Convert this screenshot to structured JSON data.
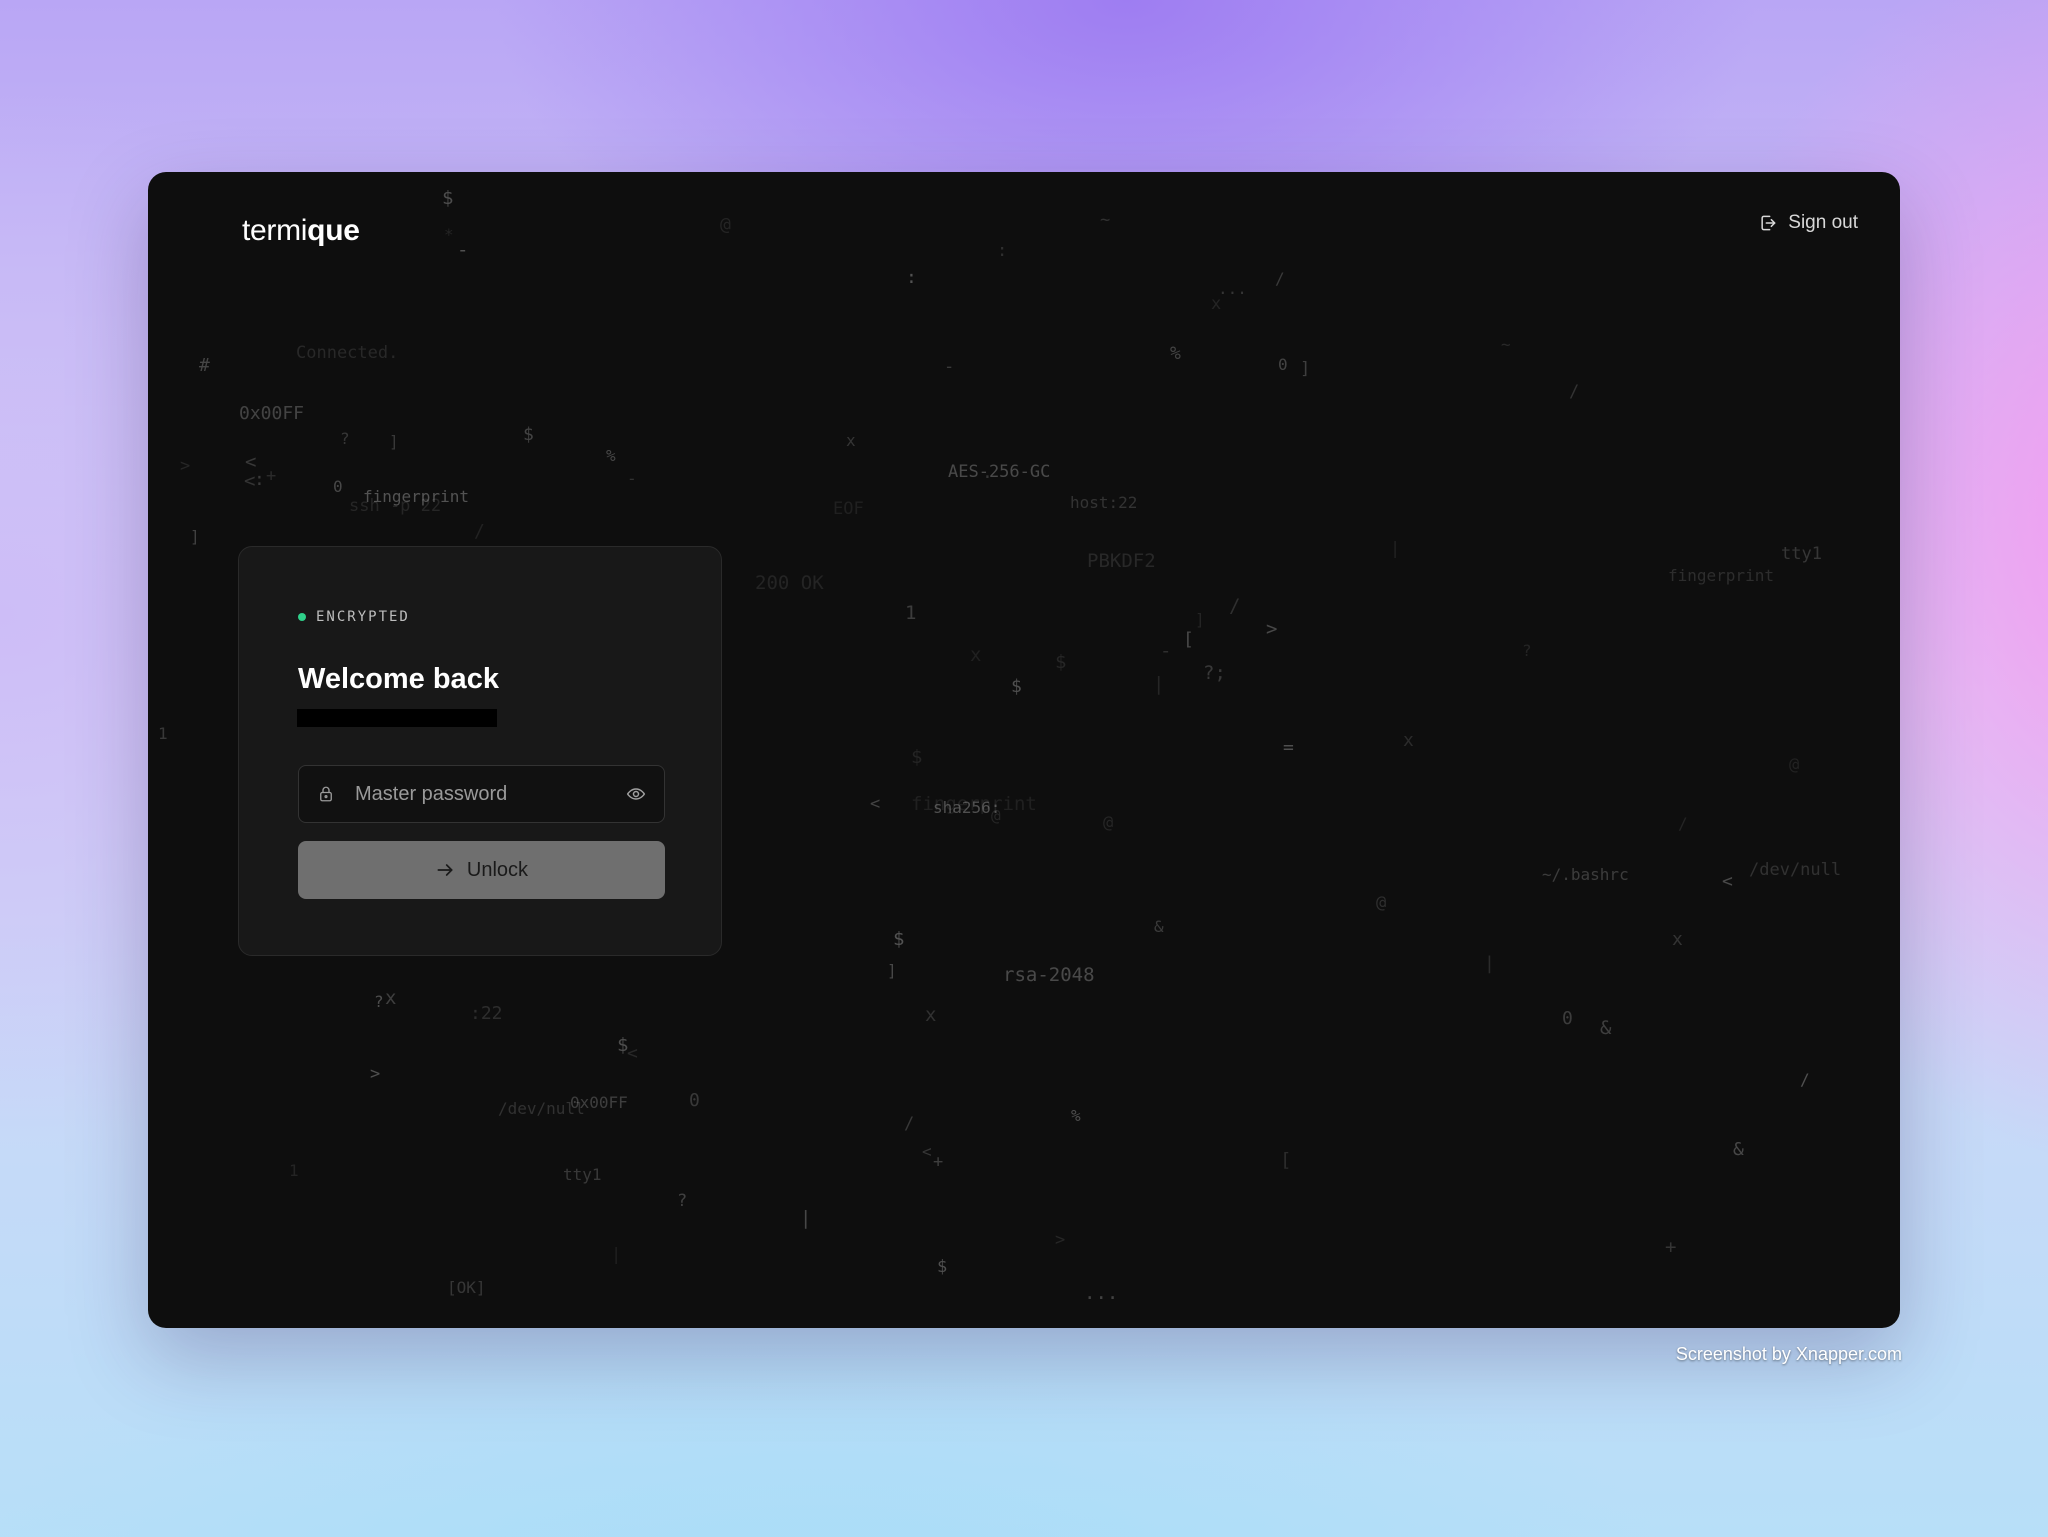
{
  "app": {
    "logo_light": "termi",
    "logo_bold": "que"
  },
  "header": {
    "signout_label": "Sign out",
    "signout_icon": "sign-out-icon"
  },
  "card": {
    "badge": "ENCRYPTED",
    "badge_color": "#2fd08a",
    "title": "Welcome back",
    "password": {
      "placeholder": "Master password",
      "value": ""
    },
    "unlock_label": "Unlock"
  },
  "background_glyphs": [
    "@",
    "$",
    "-",
    "/",
    "]",
    "-",
    "fingerprint",
    "<",
    "[OK]",
    "PBKDF2",
    "200 OK",
    "tty1",
    "[",
    "]",
    "0x00FF",
    "tty1",
    "/",
    "%",
    "$",
    "&",
    "~",
    "$",
    "|",
    "|",
    "+",
    ">",
    "#",
    "[",
    "*",
    "%",
    ":",
    "+",
    "~",
    "...",
    "x",
    "x",
    "@",
    "1",
    "/",
    "1",
    "$",
    "=",
    "$",
    "rsa-2048",
    "...",
    ":",
    ">",
    "$",
    "<",
    "0",
    "/dev/null",
    "@",
    ":22",
    "?",
    "/",
    "/",
    ".",
    "@",
    "sha256:",
    "x",
    "?",
    "host:22",
    "x",
    "+",
    "?",
    "x",
    "-",
    "<",
    "<",
    "/dev/null",
    "@",
    "0",
    "]",
    "|",
    "<",
    "fingerprint",
    "<",
    "~/.bashrc",
    "-",
    "0x00FF",
    "&",
    "1",
    "x",
    "$",
    "$",
    "&",
    "]",
    "/",
    "%",
    ">",
    ":",
    ">",
    "Connected.",
    "ssh -p 22",
    "0",
    "x",
    "AES-256-GC",
    "?;",
    "?",
    "|",
    "0",
    "EOF",
    "|",
    "fingerprint",
    "]",
    "/"
  ],
  "footer": {
    "credit": "Screenshot by Xnapper.com"
  }
}
